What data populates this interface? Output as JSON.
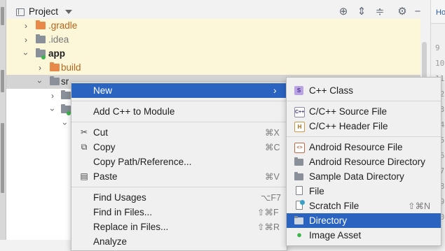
{
  "project_panel": {
    "title": "Project",
    "toolbar_icons": [
      "locate-icon",
      "expand-all-icon",
      "collapse-all-icon",
      "gear-icon",
      "minimize-icon"
    ]
  },
  "editor": {
    "tab_label": "Ho",
    "line_numbers": [
      "9",
      "10",
      "11",
      "12",
      "13",
      "14",
      "15",
      "16",
      "17",
      "18",
      "19",
      "20"
    ]
  },
  "tree": {
    "items": [
      {
        "label": ".gradle",
        "expanded": false,
        "folder_color": "#e8894a"
      },
      {
        "label": ".idea",
        "expanded": false,
        "folder_color": "#8a9099"
      },
      {
        "label": "app",
        "expanded": true,
        "folder_color": "#8a9099"
      },
      {
        "label": "build",
        "expanded": false,
        "folder_color": "#e8894a"
      },
      {
        "label": "sr",
        "expanded": true,
        "folder_color": "#8a9099"
      }
    ]
  },
  "context_menu": {
    "items": [
      {
        "label": "New",
        "has_submenu": true,
        "active": true
      },
      {
        "label": "Add C++ to Module"
      },
      {
        "label": "Cut",
        "shortcut": "⌘X",
        "icon": "scissors-icon"
      },
      {
        "label": "Copy",
        "shortcut": "⌘C",
        "icon": "copy-icon"
      },
      {
        "label": "Copy Path/Reference..."
      },
      {
        "label": "Paste",
        "shortcut": "⌘V",
        "icon": "paste-icon"
      },
      {
        "label": "Find Usages",
        "shortcut": "⌥F7"
      },
      {
        "label": "Find in Files...",
        "shortcut": "⇧⌘F"
      },
      {
        "label": "Replace in Files...",
        "shortcut": "⇧⌘R"
      },
      {
        "label": "Analyze"
      }
    ]
  },
  "new_submenu": {
    "items": [
      {
        "label": "C++ Class",
        "icon": "cpp-class-icon"
      },
      {
        "label": "C/C++ Source File",
        "icon": "cpp-source-icon"
      },
      {
        "label": "C/C++ Header File",
        "icon": "cpp-header-icon"
      },
      {
        "label": "Android Resource File",
        "icon": "android-resource-file-icon"
      },
      {
        "label": "Android Resource Directory",
        "icon": "folder-icon"
      },
      {
        "label": "Sample Data Directory",
        "icon": "folder-icon"
      },
      {
        "label": "File",
        "icon": "file-icon"
      },
      {
        "label": "Scratch File",
        "shortcut": "⇧⌘N",
        "icon": "scratch-file-icon"
      },
      {
        "label": "Directory",
        "icon": "folder-icon",
        "active": true
      },
      {
        "label": "Image Asset",
        "icon": "android-icon"
      }
    ]
  },
  "colors": {
    "menu_active": "#2b63c0",
    "row_highlight": "#fbf7d8",
    "selected_row": "#d4d4d4",
    "module_dot": "#3bb44a"
  }
}
